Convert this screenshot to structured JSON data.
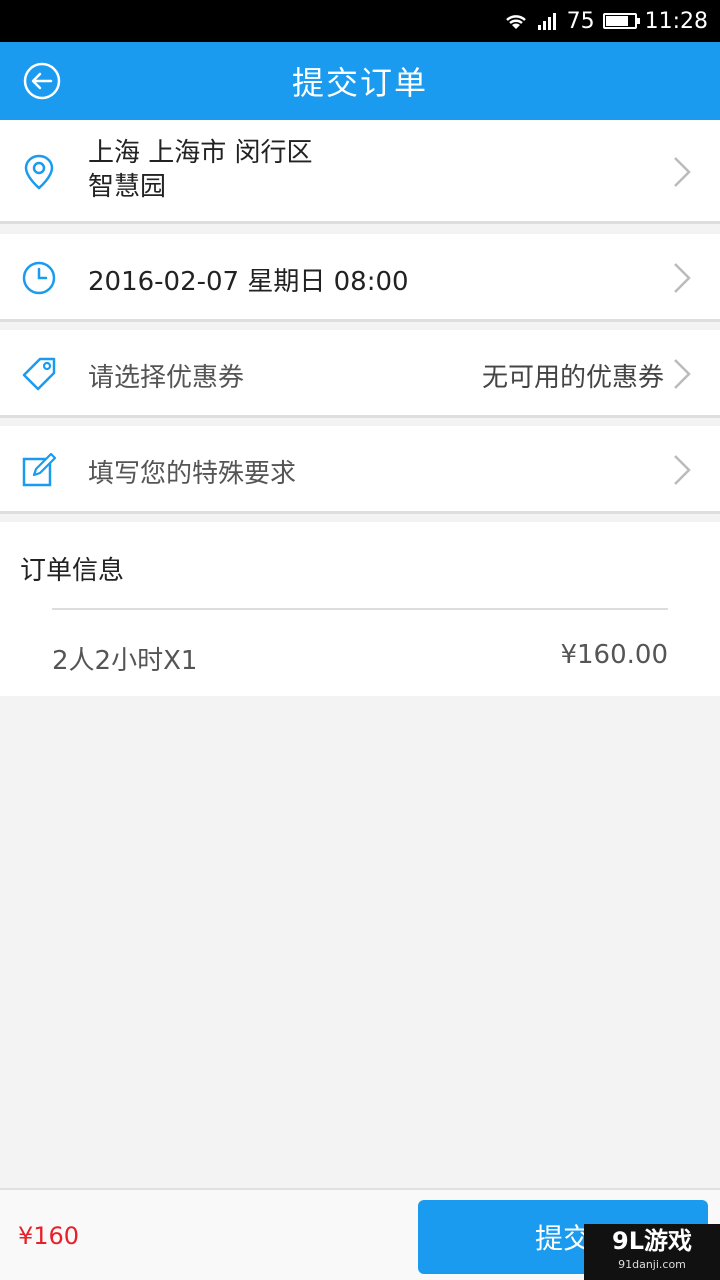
{
  "status_bar": {
    "signal": "75",
    "time": "11:28"
  },
  "header": {
    "title": "提交订单"
  },
  "address": {
    "line1": "上海 上海市 闵行区",
    "line2": "智慧园"
  },
  "time_row": {
    "value": "2016-02-07 星期日 08:00"
  },
  "coupon_row": {
    "label": "请选择优惠券",
    "status": "无可用的优惠券"
  },
  "request_row": {
    "label": "填写您的特殊要求"
  },
  "order_info": {
    "title": "订单信息",
    "items": [
      {
        "name": "2人2小时X1",
        "price": "¥160.00"
      }
    ]
  },
  "footer": {
    "total": "¥160",
    "submit_label": "提交"
  },
  "watermark": {
    "logo": "9L游戏",
    "site": "91danji.com"
  },
  "colors": {
    "accent": "#1a9bf0",
    "price_red": "#e8202a"
  },
  "icons": [
    "back-arrow-icon",
    "location-pin-icon",
    "clock-icon",
    "coupon-tag-icon",
    "edit-icon",
    "chevron-right-icon",
    "wifi-icon",
    "cellular-signal-icon",
    "battery-icon"
  ]
}
